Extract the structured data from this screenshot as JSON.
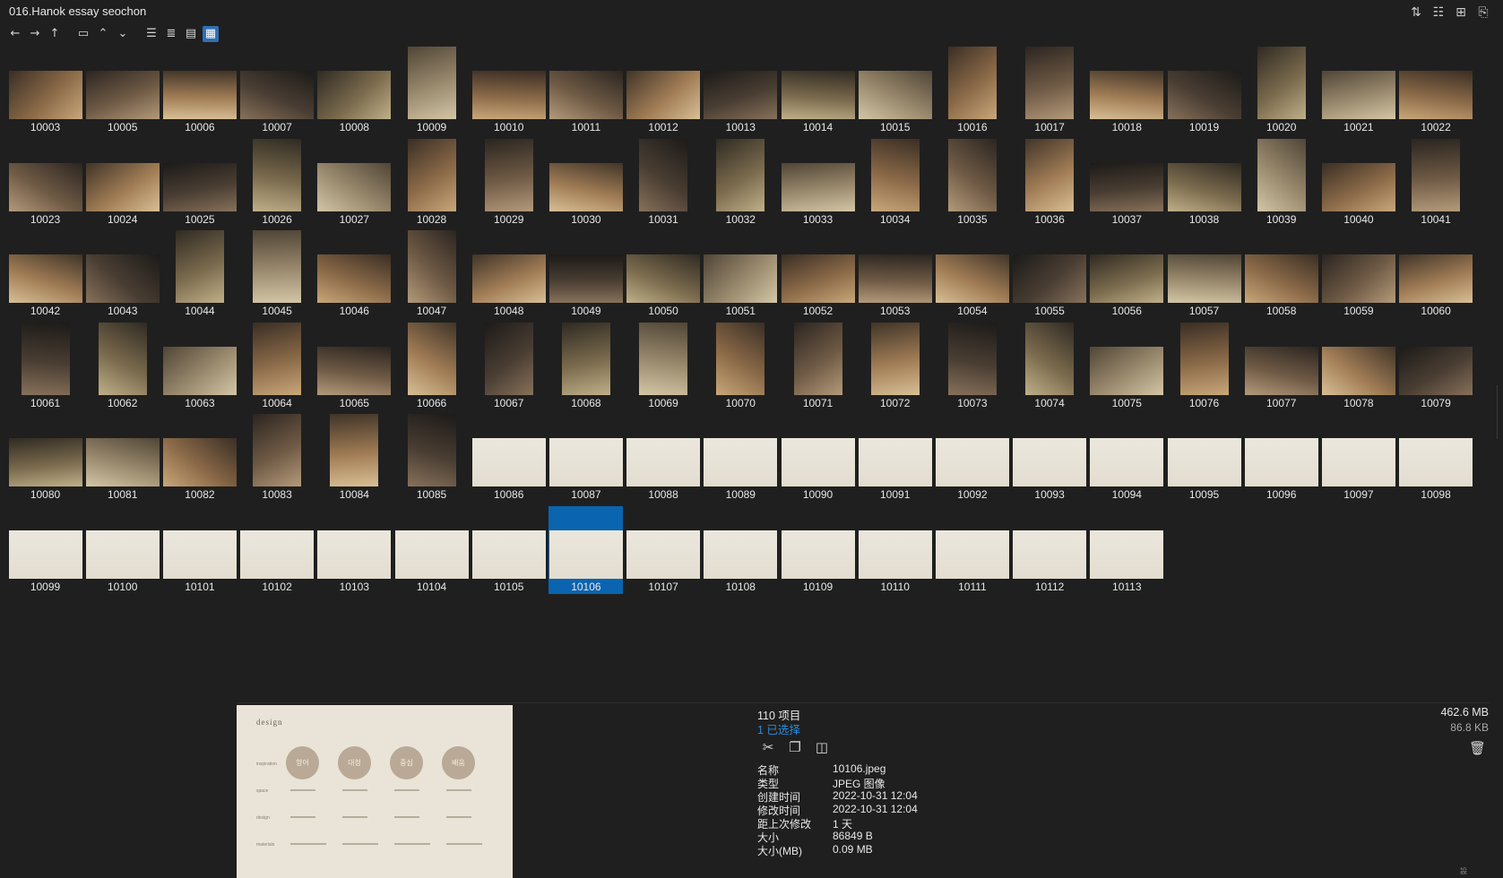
{
  "window": {
    "title": "016.Hanok essay seochon"
  },
  "toolbar": {
    "buttons": [
      {
        "name": "back-button",
        "icon": "arrow-left-icon",
        "glyph": "←"
      },
      {
        "name": "forward-button",
        "icon": "arrow-right-icon",
        "glyph": "→"
      },
      {
        "name": "up-button",
        "icon": "arrow-up-icon",
        "glyph": "↑"
      },
      {
        "name": "folder-button",
        "icon": "folder-icon",
        "glyph": "▭"
      },
      {
        "name": "collapse-button",
        "icon": "chevron-up-icon",
        "glyph": "⌃"
      },
      {
        "name": "expand-button",
        "icon": "chevron-down-icon",
        "glyph": "⌄"
      },
      {
        "name": "view-list-button",
        "icon": "list-view-icon",
        "glyph": "☰"
      },
      {
        "name": "view-details-button",
        "icon": "details-view-icon",
        "glyph": "≣"
      },
      {
        "name": "view-tiles-button",
        "icon": "tiles-view-icon",
        "glyph": "▤"
      },
      {
        "name": "view-thumbnails-button",
        "icon": "thumbnails-view-icon",
        "glyph": "▦",
        "active": true
      }
    ],
    "right_icons": [
      {
        "name": "sort-button",
        "icon": "sort-icon",
        "glyph": "⇅"
      },
      {
        "name": "tree-view-button",
        "icon": "tree-view-icon",
        "glyph": "☷"
      },
      {
        "name": "add-pane-button",
        "icon": "add-pane-icon",
        "glyph": "⊞"
      },
      {
        "name": "clipboard-button",
        "icon": "clipboard-icon",
        "glyph": "⎘"
      }
    ]
  },
  "files": [
    "10003",
    "10005",
    "10006",
    "10007",
    "10008",
    "10009",
    "10010",
    "10011",
    "10012",
    "10013",
    "10014",
    "10015",
    "10016",
    "10017",
    "10018",
    "10019",
    "10020",
    "10021",
    "10022",
    "10023",
    "10024",
    "10025",
    "10026",
    "10027",
    "10028",
    "10029",
    "10030",
    "10031",
    "10032",
    "10033",
    "10034",
    "10035",
    "10036",
    "10037",
    "10038",
    "10039",
    "10040",
    "10041",
    "10042",
    "10043",
    "10044",
    "10045",
    "10046",
    "10047",
    "10048",
    "10049",
    "10050",
    "10051",
    "10052",
    "10053",
    "10054",
    "10055",
    "10056",
    "10057",
    "10058",
    "10059",
    "10060",
    "10061",
    "10062",
    "10063",
    "10064",
    "10065",
    "10066",
    "10067",
    "10068",
    "10069",
    "10070",
    "10071",
    "10072",
    "10073",
    "10074",
    "10075",
    "10076",
    "10077",
    "10078",
    "10079",
    "10080",
    "10081",
    "10082",
    "10083",
    "10084",
    "10085",
    "10086",
    "10087",
    "10088",
    "10089",
    "10090",
    "10091",
    "10092",
    "10093",
    "10094",
    "10095",
    "10096",
    "10097",
    "10098",
    "10099",
    "10100",
    "10101",
    "10102",
    "10103",
    "10104",
    "10105",
    "10106",
    "10107",
    "10108",
    "10109",
    "10110",
    "10111",
    "10112",
    "10113"
  ],
  "selected_file": "10106",
  "preview": {
    "title": "design",
    "circles": [
      "향어",
      "대청",
      "중심",
      "배움"
    ],
    "row_labels": [
      "inspiration",
      "space",
      "design",
      "materials"
    ]
  },
  "status": {
    "item_count": "110 项目",
    "selected_count": "1 已选择",
    "total_size": "462.6 MB",
    "selected_size": "86.8 KB"
  },
  "actions": [
    {
      "name": "cut-button",
      "icon": "scissors-icon",
      "glyph": "✂"
    },
    {
      "name": "copy-button",
      "icon": "copy-icon",
      "glyph": "❐"
    },
    {
      "name": "move-button",
      "icon": "move-icon",
      "glyph": "◫"
    }
  ],
  "trash_glyph": "🗑",
  "properties": [
    {
      "key": "名称",
      "value": "10106.jpeg"
    },
    {
      "key": "类型",
      "value": "JPEG 图像"
    },
    {
      "key": "创建时间",
      "value": "2022-10-31  12:04"
    },
    {
      "key": "修改时间",
      "value": "2022-10-31  12:04"
    },
    {
      "key": "距上次修改",
      "value": "1 天"
    },
    {
      "key": "大小",
      "value": "86849 B"
    },
    {
      "key": "大小(MB)",
      "value": "0.09 MB"
    }
  ],
  "corner_text": "設"
}
